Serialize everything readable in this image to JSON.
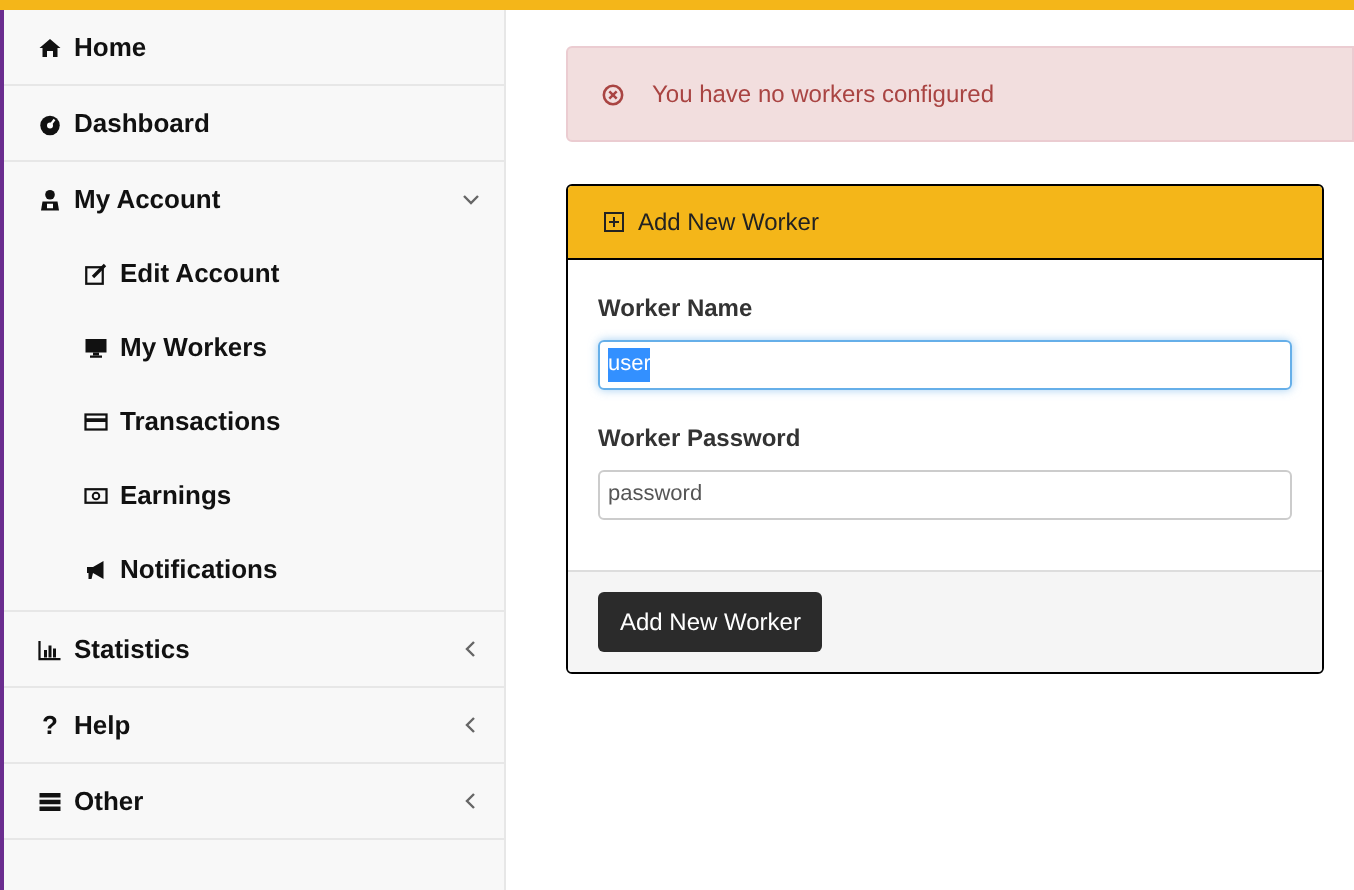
{
  "sidebar": {
    "items": [
      {
        "label": "Home"
      },
      {
        "label": "Dashboard"
      },
      {
        "label": "My Account",
        "expanded": true,
        "children": [
          {
            "label": "Edit Account"
          },
          {
            "label": "My Workers"
          },
          {
            "label": "Transactions"
          },
          {
            "label": "Earnings"
          },
          {
            "label": "Notifications"
          }
        ]
      },
      {
        "label": "Statistics",
        "expanded": false
      },
      {
        "label": "Help",
        "glyph": "?",
        "expanded": false
      },
      {
        "label": "Other",
        "expanded": false
      }
    ]
  },
  "alert": {
    "kind": "error",
    "text": "You have no workers configured"
  },
  "panel": {
    "title": "Add New Worker",
    "fields": [
      {
        "label": "Worker Name",
        "value": "user",
        "focused": true,
        "text_selected": true
      },
      {
        "label": "Worker Password",
        "value": "password",
        "focused": false,
        "text_selected": false
      }
    ],
    "button": "Add New Worker"
  }
}
